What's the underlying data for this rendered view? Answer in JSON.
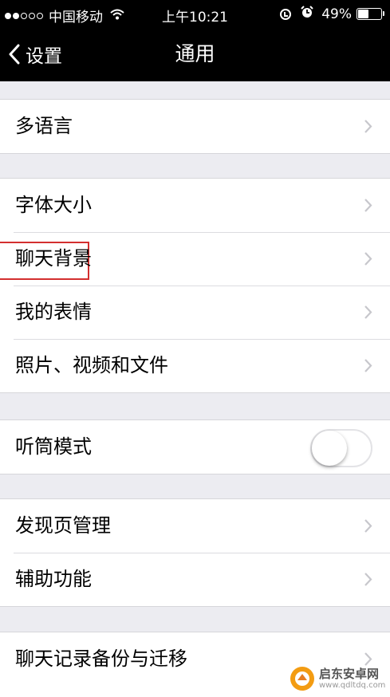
{
  "status_bar": {
    "signal_dots_filled": 2,
    "signal_dots_total": 5,
    "carrier": "中国移动",
    "wifi_icon": "wifi-icon",
    "time": "上午10:21",
    "battery_percent": "49%",
    "battery_level": 0.49
  },
  "nav": {
    "back_label": "设置",
    "title": "通用"
  },
  "settings": {
    "language": "多语言",
    "font_size": "字体大小",
    "chat_background": "聊天背景",
    "my_stickers": "我的表情",
    "photos_videos_files": "照片、视频和文件",
    "earpiece_mode": "听筒模式",
    "earpiece_mode_on": false,
    "discover_management": "发现页管理",
    "accessibility": "辅助功能",
    "chat_backup": "聊天记录备份与迁移"
  },
  "watermark": {
    "name": "启东安卓网",
    "url": "www.qdltdq.com"
  },
  "colors": {
    "nav_background": "#000000",
    "page_background": "#ececf1",
    "highlight_box": "#d32f2f",
    "chevron": "#c7c7cc"
  }
}
